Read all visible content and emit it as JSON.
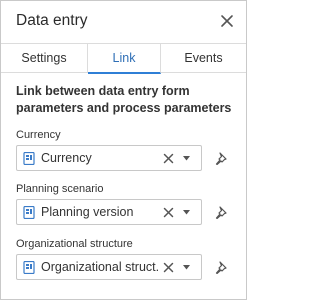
{
  "panel": {
    "title": "Data entry"
  },
  "tabs": [
    {
      "label": "Settings",
      "active": false
    },
    {
      "label": "Link",
      "active": true
    },
    {
      "label": "Events",
      "active": false
    }
  ],
  "description": "Link between data entry form parameters and process parameters",
  "parameters": [
    {
      "label": "Currency",
      "value": "Currency"
    },
    {
      "label": "Planning scenario",
      "value": "Planning version"
    },
    {
      "label": "Organizational structure",
      "value": "Organizational struct..."
    }
  ],
  "colors": {
    "accent": "#2f7fd6",
    "dictionary_icon": "#3a7bc8"
  },
  "icons": {
    "close": "close-icon",
    "dictionary": "dictionary-icon",
    "clear": "clear-icon",
    "dropdown": "chevron-down-icon",
    "pin": "pin-icon"
  }
}
